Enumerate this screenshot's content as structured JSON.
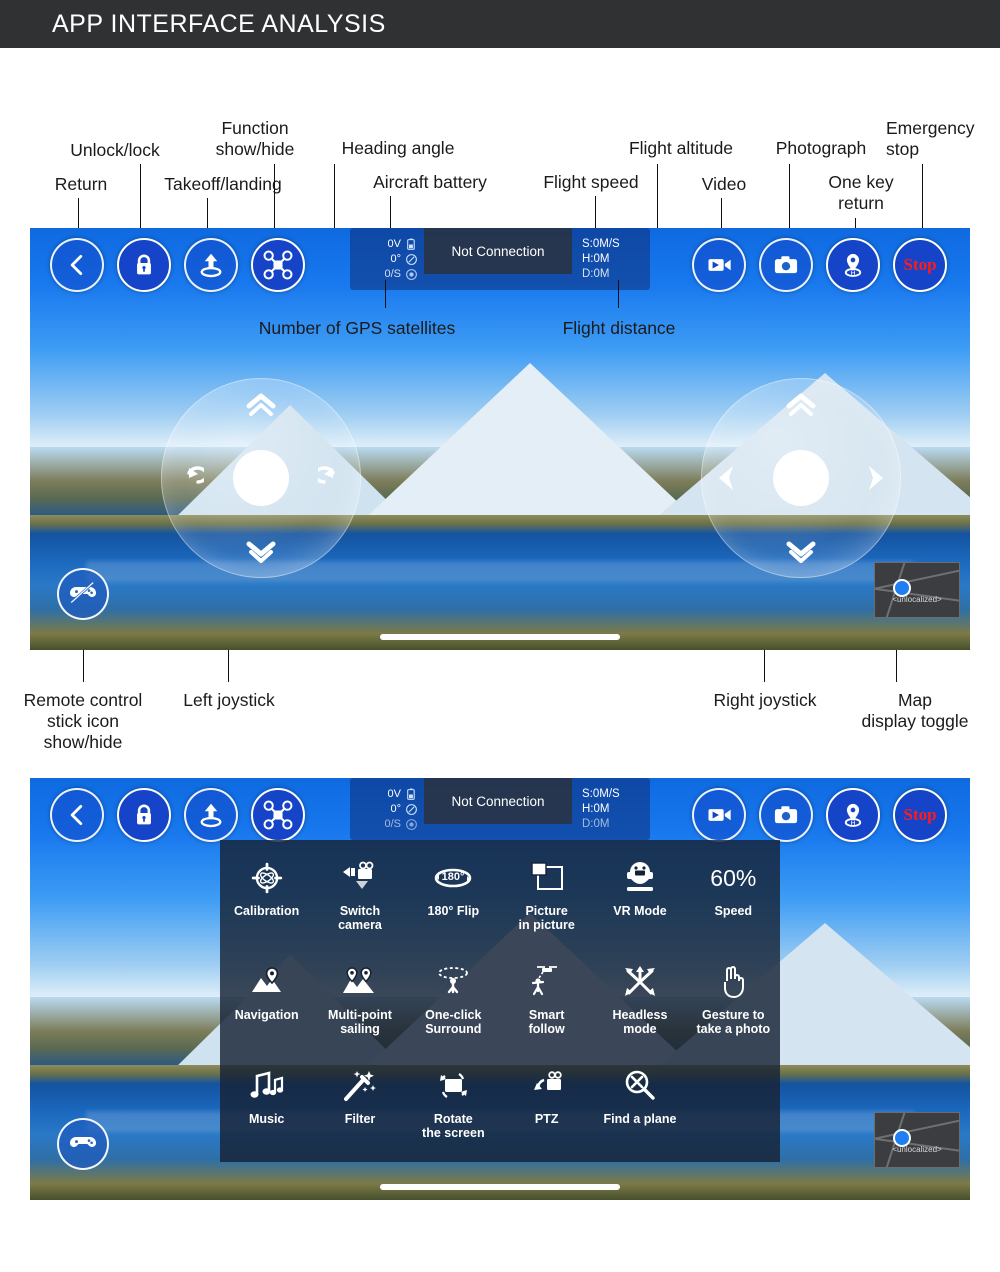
{
  "header": {
    "title": "APP INTERFACE ANALYSIS"
  },
  "annotations": {
    "return": "Return",
    "unlock_lock": "Unlock/lock",
    "takeoff_landing": "Takeoff/landing",
    "function_show_hide": "Function\nshow/hide",
    "heading_angle": "Heading angle",
    "aircraft_battery": "Aircraft battery",
    "flight_speed": "Flight speed",
    "flight_altitude": "Flight altitude",
    "video": "Video",
    "photograph": "Photograph",
    "one_key_return": "One key\nreturn",
    "emergency_stop": "Emergency\nstop",
    "gps_satellites": "Number of GPS satellites",
    "flight_distance": "Flight distance",
    "remote_stick_toggle": "Remote control\nstick icon\nshow/hide",
    "left_joystick": "Left joystick",
    "right_joystick": "Right joystick",
    "map_display_toggle": "Map\ndisplay toggle"
  },
  "hud": {
    "left_buttons": [
      {
        "name": "back-button",
        "icon": "chevron-left-icon"
      },
      {
        "name": "lock-button",
        "icon": "lock-icon"
      },
      {
        "name": "takeoff-landing-button",
        "icon": "takeoff-icon"
      },
      {
        "name": "function-toggle-button",
        "icon": "drone-icon"
      }
    ],
    "right_buttons": [
      {
        "name": "video-button",
        "icon": "video-camera-icon",
        "label": ""
      },
      {
        "name": "photo-button",
        "icon": "camera-icon",
        "label": ""
      },
      {
        "name": "return-home-button",
        "icon": "home-pin-icon",
        "label": ""
      },
      {
        "name": "emergency-stop-button",
        "icon": "stop-text-icon",
        "label": "Stop"
      }
    ],
    "telemetry": {
      "battery_voltage": "0V",
      "heading_angle": "0°",
      "gps_satellites": "0/S",
      "connection_status": "Not Connection",
      "speed": "S:0M/S",
      "height": "H:0M",
      "distance": "D:0M"
    },
    "minimap_label": "<unlocalized>"
  },
  "function_menu": {
    "rows": [
      [
        {
          "label": "Calibration",
          "icon": "calibration-icon"
        },
        {
          "label": "Switch\ncamera",
          "icon": "switch-camera-icon"
        },
        {
          "label": "180° Flip",
          "icon": "flip-180-icon"
        },
        {
          "label": "Picture\nin picture",
          "icon": "picture-in-picture-icon"
        },
        {
          "label": "VR Mode",
          "icon": "vr-goggles-icon"
        },
        {
          "label": "Speed",
          "icon": "speed-value",
          "value": "60%"
        }
      ],
      [
        {
          "label": "Navigation",
          "icon": "map-pin-icon"
        },
        {
          "label": "Multi-point\nsailing",
          "icon": "multi-pin-icon"
        },
        {
          "label": "One-click\nSurround",
          "icon": "surround-icon"
        },
        {
          "label": "Smart\nfollow",
          "icon": "smart-follow-icon"
        },
        {
          "label": "Headless\nmode",
          "icon": "headless-arrows-icon"
        },
        {
          "label": "Gesture to\ntake a photo",
          "icon": "hand-gesture-icon"
        }
      ],
      [
        {
          "label": "Music",
          "icon": "music-notes-icon"
        },
        {
          "label": "Filter",
          "icon": "magic-wand-icon"
        },
        {
          "label": "Rotate\nthe screen",
          "icon": "rotate-screen-icon"
        },
        {
          "label": "PTZ",
          "icon": "ptz-camera-icon"
        },
        {
          "label": "Find a plane",
          "icon": "find-plane-icon"
        }
      ]
    ]
  },
  "colors": {
    "title_bar": "#2f3133",
    "stop_red": "#ff1b1b",
    "hud_blue": "#1644c8",
    "menu_overlay": "#162234"
  }
}
